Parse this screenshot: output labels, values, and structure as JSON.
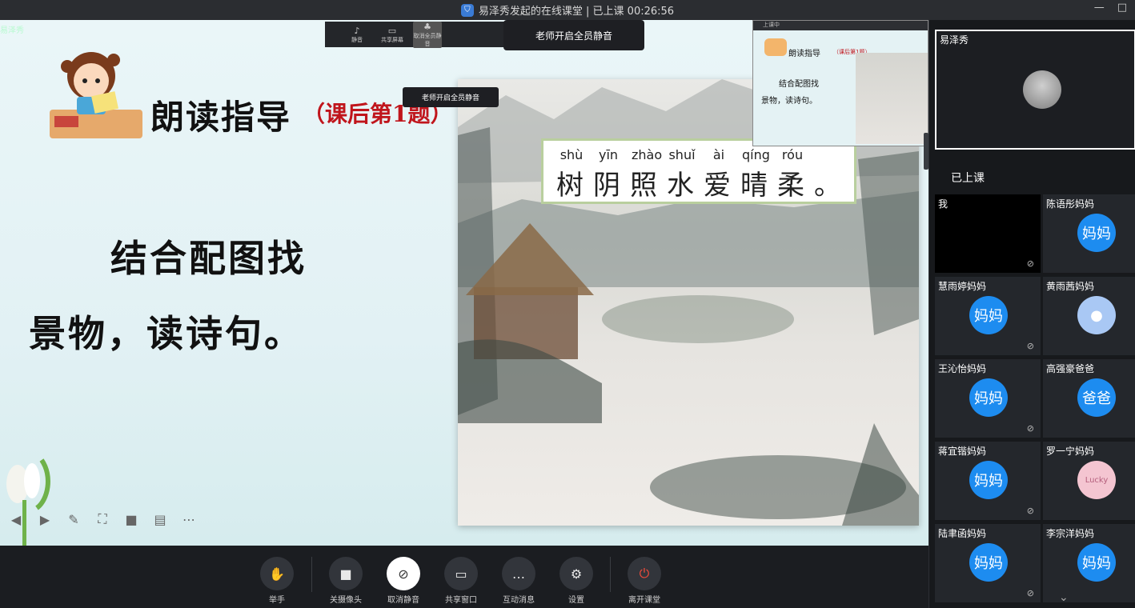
{
  "window": {
    "title": "易泽秀发起的在线课堂 | 已上课 00:26:56",
    "minimize": "—",
    "maximize": "□"
  },
  "slide": {
    "presenter_tag": "易泽秀",
    "title": "朗读指导",
    "subtitle": "（课后第1题）",
    "line1": "结合配图找",
    "line2": "景物，读诗句。"
  },
  "poem": {
    "pinyin": [
      "shù",
      "yīn",
      "zhào",
      "shuǐ",
      "ài",
      "qíng",
      "róu"
    ],
    "hanzi": [
      "树",
      "阴",
      "照",
      "水",
      "爱",
      "晴",
      "柔",
      "。"
    ]
  },
  "mini_toolbar": {
    "items": [
      {
        "label": "静音",
        "icon": "mic-icon"
      },
      {
        "label": "共享屏幕",
        "icon": "screen-icon"
      },
      {
        "label": "取消全员静音",
        "icon": "group-icon"
      }
    ]
  },
  "toasts": {
    "mute_all": "老师开启全员静音",
    "mute_all_small": "老师开启全员静音"
  },
  "pip": {
    "top": "上课中",
    "title": "朗读指导",
    "subtitle": "（课后第1题）",
    "line1": "结合配图找",
    "line2": "景物，读诗句。"
  },
  "controls": [
    {
      "label": "举手",
      "icon": "hand-icon"
    },
    {
      "label": "关摄像头",
      "icon": "camera-icon"
    },
    {
      "label": "取消静音",
      "icon": "mic-muted-icon"
    },
    {
      "label": "共享窗口",
      "icon": "share-window-icon"
    },
    {
      "label": "互动消息",
      "icon": "chat-icon"
    },
    {
      "label": "设置",
      "icon": "gear-icon"
    },
    {
      "label": "离开课堂",
      "icon": "power-icon"
    }
  ],
  "teacher": {
    "name": "易泽秀"
  },
  "section_label": "已上课",
  "participants": [
    {
      "name": "我",
      "avatar": ""
    },
    {
      "name": "陈语彤妈妈",
      "avatar": "妈妈"
    },
    {
      "name": "慧雨婷妈妈",
      "avatar": "妈妈"
    },
    {
      "name": "黄雨茜妈妈",
      "avatar": ""
    },
    {
      "name": "王沁怡妈妈",
      "avatar": "妈妈"
    },
    {
      "name": "高强豪爸爸",
      "avatar": "爸爸"
    },
    {
      "name": "蒋宜锴妈妈",
      "avatar": "妈妈"
    },
    {
      "name": "罗一宁妈妈",
      "avatar": "Lucky"
    },
    {
      "name": "陆聿函妈妈",
      "avatar": "妈妈"
    },
    {
      "name": "李宗洋妈妈",
      "avatar": "妈妈"
    }
  ],
  "colors": {
    "accent": "#1d8cf0",
    "leave": "#f04b3b",
    "subtitle_red": "#c0151c"
  }
}
